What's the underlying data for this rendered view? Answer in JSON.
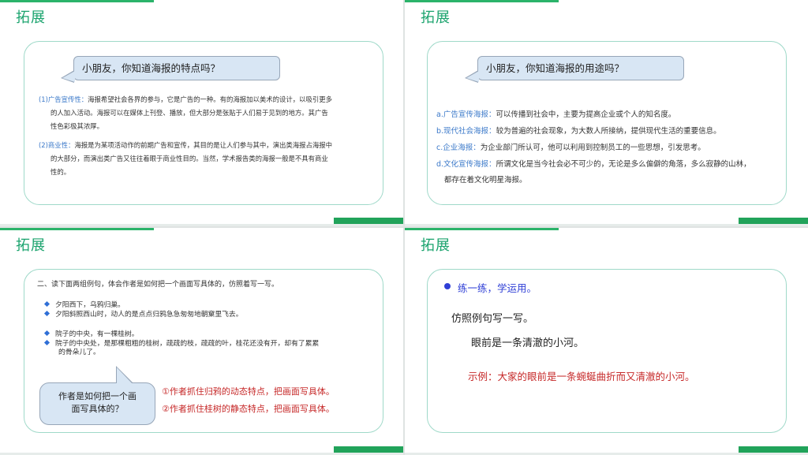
{
  "slide1": {
    "title": "拓展",
    "question": "小朋友，你知道海报的特点吗？",
    "paragraphs": [
      {
        "label": "(1)广告宣传性：",
        "lines": [
          "海报希望社会各界的参与，它是广告的一种。有的海报加以美术的设计，以吸引更多",
          "的人加入活动。海报可以在媒体上刊登、播放，但大部分是张贴于人们易于见到的地方。其广告",
          "性色彩极其浓厚。"
        ]
      },
      {
        "label": "(2)商业性：",
        "lines": [
          "海报是为某项活动作的前期广告和宣传，其目的是让人们参与其中，演出类海报占海报中",
          "的大部分，而演出类广告又往往着眼于商业性目的。当然，学术报告类的海报一般是不具有商业",
          "性的。"
        ]
      }
    ]
  },
  "slide2": {
    "title": "拓展",
    "question": "小朋友，你知道海报的用途吗？",
    "items": [
      {
        "label": "a.广告宣传海报：",
        "text": "可以传播到社会中，主要为提高企业或个人的知名度。"
      },
      {
        "label": "b.现代社会海报：",
        "text": "较为普遍的社会现象，为大数人所接纳，提供现代生活的重要信息。"
      },
      {
        "label": "c.企业海报：",
        "text": "为企业部门所认可，他可以利用到控制员工的一些思想，引发思考。"
      },
      {
        "label": "d.文化宣传海报：",
        "text": "所谓文化是当今社会必不可少的，无论是多么偏僻的角落，多么寂静的山林，",
        "cont": "都存在着文化明星海报。"
      }
    ]
  },
  "slide3": {
    "title": "拓展",
    "instruction": "二、读下面两组例句，体会作者是如何把一个画面写具体的，仿照着写一写。",
    "group1": [
      "夕阳西下，乌鸦归巢。",
      "夕阳斜照西山时，动人的是点点归鸦急急匆匆地朝窠里飞去。"
    ],
    "group2": [
      "院子的中央，有一棵桂树。",
      "院子的中央处，是那棵粗粗的桂树，疏疏的枝，疏疏的叶，桂花还没有开，却有了累累",
      "的骨朵儿了。"
    ],
    "bubble": [
      "作者是如何把一个画",
      "面写具体的？"
    ],
    "answers": [
      "①作者抓住归鸦的动态特点，把画面写具体。",
      "②作者抓住桂树的静态特点，把画面写具体。"
    ]
  },
  "slide4": {
    "title": "拓展",
    "heading": "练一练，学运用。",
    "prompt": "仿照例句写一写。",
    "sentence": "眼前是一条清澈的小河。",
    "example": "示例：大家的眼前是一条蜿蜒曲折而又清澈的小河。"
  }
}
